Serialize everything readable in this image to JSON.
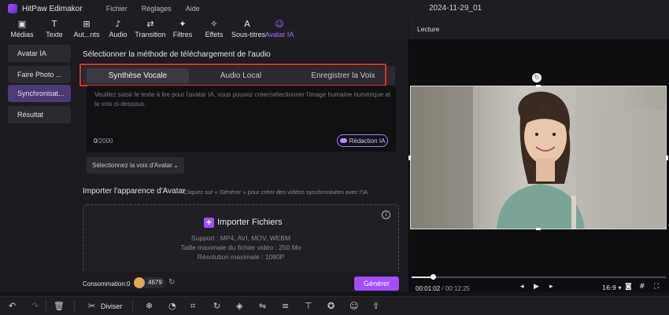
{
  "titlebar": {
    "app_name": "HitPaw Edimakor",
    "menu": [
      "Fichier",
      "Réglages",
      "Aide"
    ],
    "document_title": "2024-11-29_01"
  },
  "toolbar": {
    "tools": [
      {
        "label": "Médias",
        "icon": "media-icon"
      },
      {
        "label": "Texte",
        "icon": "text-icon"
      },
      {
        "label": "Aut...nts",
        "icon": "autocomponents-icon"
      },
      {
        "label": "Audio",
        "icon": "audio-note-icon"
      },
      {
        "label": "Transition",
        "icon": "transition-icon"
      },
      {
        "label": "Filtres",
        "icon": "filters-icon"
      },
      {
        "label": "Effets",
        "icon": "effects-icon"
      },
      {
        "label": "Sous-titres",
        "icon": "subtitles-icon"
      },
      {
        "label": "Avatar IA",
        "icon": "avatar-ai-icon"
      }
    ],
    "active": "Avatar IA"
  },
  "sidebar": {
    "items": [
      {
        "label": "Avatar IA"
      },
      {
        "label": "Faire Photo ..."
      },
      {
        "label": "Synchronisat..."
      },
      {
        "label": "Résultat"
      }
    ],
    "active_index": 2
  },
  "audio": {
    "heading": "Sélectionner la méthode de téléchargement de l'audio",
    "tabs": [
      "Synthèse Vocale",
      "Audio Local",
      "Enregistrer la Voix"
    ],
    "active_tab": 0,
    "textarea_placeholder": "Veuillez saisir le texte à lire pour l'avatar IA, vous pouvez créer/sélectionner l'image humaine numérique et la voix ci-dessous.",
    "char_count": "0",
    "char_limit": "/2000",
    "redaction_label": "Rédaction IA",
    "voice_select": "Sélectionnez la voix d'Avatar"
  },
  "import": {
    "heading": "Importer l'apparence d'Avatar",
    "hint": "Cliquez sur « Générer » pour créer des vidéos synchronisées avec l'IA.",
    "button": "Importer Fichiers",
    "support": "Support : MP4, AVI, MOV, WEBM",
    "max_size": "Taille maximale du fichier vidéo : 250 Mo",
    "max_res": "Résolution maximale : 1080P"
  },
  "footer": {
    "consumption_label": "Consommation:0",
    "credits": "4679",
    "generate_label": "Générer"
  },
  "preview": {
    "label": "Lecture",
    "time_current": "00:01:02",
    "time_total": "/ 00:12:25",
    "progress": 0.083,
    "aspect_ratio": "16:9"
  },
  "bottom_toolbar": {
    "diviser_label": "Diviser"
  },
  "colors": {
    "accent": "#a24dff",
    "highlight_border": "#e0302e",
    "panel_bg": "#1b1b20"
  }
}
